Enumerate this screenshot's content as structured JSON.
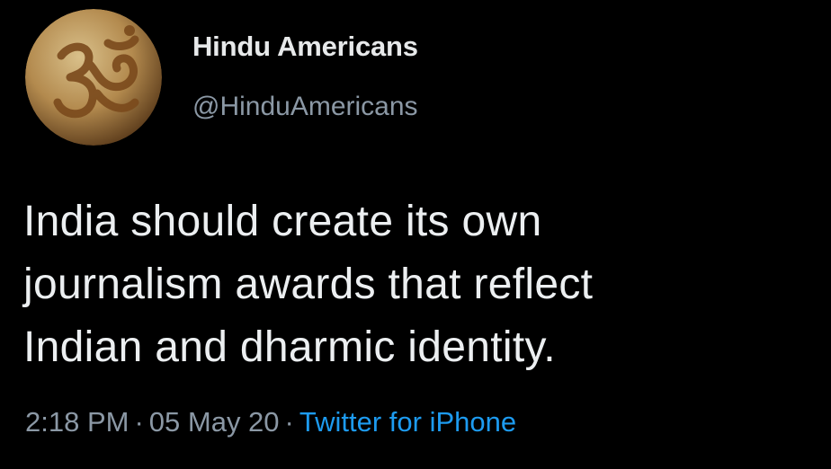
{
  "account": {
    "display_name": "Hindu Americans",
    "handle": "@HinduAmericans",
    "avatar_icon": "om-symbol-icon"
  },
  "tweet": {
    "lines": [
      "India should create its own",
      "journalism awards that reflect",
      "Indian and dharmic identity."
    ]
  },
  "meta": {
    "time": "2:18 PM",
    "separator": "·",
    "date": "05 May 20",
    "source": "Twitter for iPhone"
  },
  "colors": {
    "background": "#000000",
    "text": "#e7e9ea",
    "secondary": "#8b98a5",
    "link": "#1d9bf0"
  }
}
